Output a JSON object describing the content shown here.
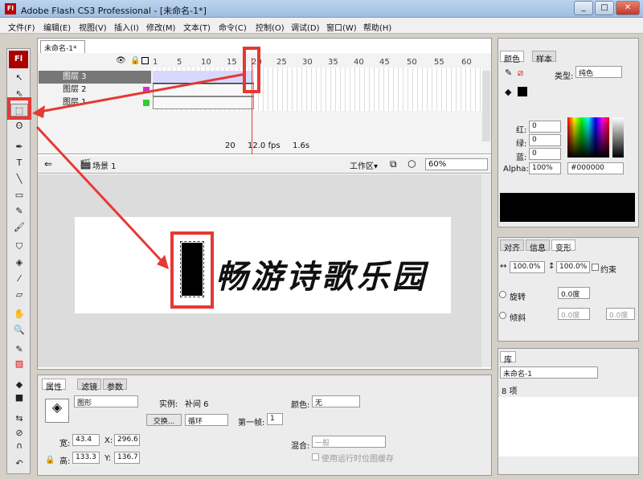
{
  "window": {
    "title": "Adobe Flash CS3 Professional - [未命名-1*]",
    "logo": "Fl",
    "min": "_",
    "max": "□",
    "close": "✕"
  },
  "menu": [
    "文件(F)",
    "编辑(E)",
    "视图(V)",
    "插入(I)",
    "修改(M)",
    "文本(T)",
    "命令(C)",
    "控制(O)",
    "调试(D)",
    "窗口(W)",
    "帮助(H)"
  ],
  "toolbox": {
    "logo": "Fl"
  },
  "document": {
    "tab": "未命名-1*"
  },
  "timeline": {
    "layers": [
      "图层 3",
      "图层 2",
      "图层 1"
    ],
    "frame_numbers": [
      "1",
      "5",
      "10",
      "15",
      "20",
      "25",
      "30",
      "35",
      "40",
      "45",
      "50",
      "55",
      "60"
    ],
    "current_frame": "20",
    "fps": "12.0 fps",
    "time": "1.6s"
  },
  "editbar": {
    "scene": "场景 1",
    "workspace": "工作区▾",
    "zoom": "60%"
  },
  "stage": {
    "text": "畅游诗歌乐园"
  },
  "properties": {
    "tabs": [
      "属性",
      "滤镜",
      "参数"
    ],
    "type_select": "图形",
    "instance_label": "实例:",
    "instance_name": "补间 6",
    "swap_button": "交换...",
    "loop_select": "循环",
    "first_frame_label": "第一帧:",
    "first_frame": "1",
    "color_label": "颜色:",
    "color_value": "无",
    "width_label": "宽:",
    "width": "43.4",
    "height_label": "高:",
    "height": "133.3",
    "x_label": "X:",
    "x": "296.6",
    "y_label": "Y:",
    "y": "136.7",
    "blend_label": "混合:",
    "blend_value": "一般",
    "cache_label": "使用运行时位图缓存"
  },
  "color_panel": {
    "tabs": [
      "颜色",
      "样本"
    ],
    "type_label": "类型:",
    "type_value": "纯色",
    "red_label": "红:",
    "red": "0",
    "green_label": "绿:",
    "green": "0",
    "blue_label": "蓝:",
    "blue": "0",
    "alpha_label": "Alpha:",
    "alpha": "100%",
    "hex": "#000000"
  },
  "transform_panel": {
    "tabs": [
      "对齐",
      "信息",
      "变形"
    ],
    "scale_w": "100.0%",
    "scale_h": "100.0%",
    "constrain": "约束",
    "rotate_label": "旋转",
    "rotate": "0.0度",
    "skew_label": "倾斜",
    "skew1": "0.0度",
    "skew2": "0.0度"
  },
  "library_panel": {
    "tab": "库",
    "doc": "未命名-1",
    "count": "8 项"
  }
}
